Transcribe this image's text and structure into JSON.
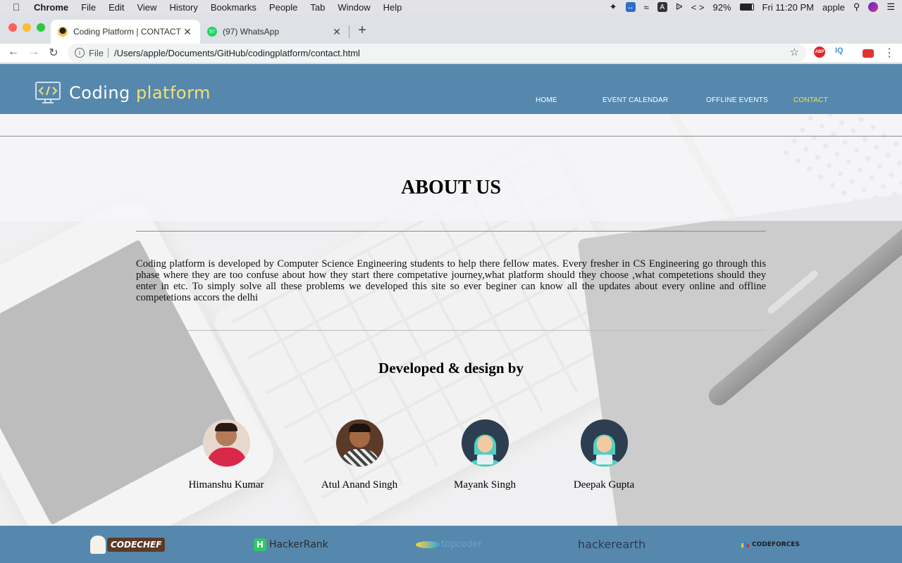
{
  "menubar": {
    "app_name": "Chrome",
    "menus": [
      "File",
      "Edit",
      "View",
      "History",
      "Bookmarks",
      "People",
      "Tab",
      "Window",
      "Help"
    ],
    "battery": "92%",
    "clock": "Fri 11:20 PM",
    "user": "apple"
  },
  "browser": {
    "tabs": [
      {
        "title": "Coding Platform | CONTACT US",
        "active": true
      },
      {
        "title": "(97) WhatsApp",
        "active": false,
        "badge": "97"
      }
    ],
    "url_scheme": "File",
    "url": "/Users/apple/Documents/GitHub/codingplatform/contact.html",
    "extensions": [
      "ABP",
      "IQ"
    ]
  },
  "site": {
    "logo_word1": "Coding",
    "logo_word2": "platform",
    "nav": [
      {
        "label": "HOME",
        "active": false
      },
      {
        "label": "EVENT CALENDAR",
        "active": false
      },
      {
        "label": "OFFLINE EVENTS",
        "active": false
      },
      {
        "label": "CONTACT",
        "active": true
      }
    ],
    "colors": {
      "header": "#5688ad",
      "active_nav": "#f4e23a",
      "logo_accent": "#f3e07b"
    }
  },
  "about": {
    "title": "ABOUT US",
    "text": "Coding platform is developed by Computer Science Engineering students to help there fellow mates. Every fresher in CS Engineering go through this phase where they are too confuse about how they start there competative journey,what platform should they choose ,what competetions should they enter in etc. To simply solve all these problems we developed this site so ever beginer can know all the updates about every online and offline competetions accors the delhi"
  },
  "team": {
    "title": "Developed & design by",
    "members": [
      {
        "name": "Himanshu Kumar",
        "avatar": "photo"
      },
      {
        "name": "Atul Anand Singh",
        "avatar": "photo"
      },
      {
        "name": "Mayank Singh",
        "avatar": "hacker-icon"
      },
      {
        "name": "Deepak Gupta",
        "avatar": "hacker-icon"
      }
    ]
  },
  "footer": {
    "logos": [
      "CODECHEF",
      "HackerRank",
      "topcoder",
      "hackerearth",
      "CODEFORCES"
    ]
  }
}
